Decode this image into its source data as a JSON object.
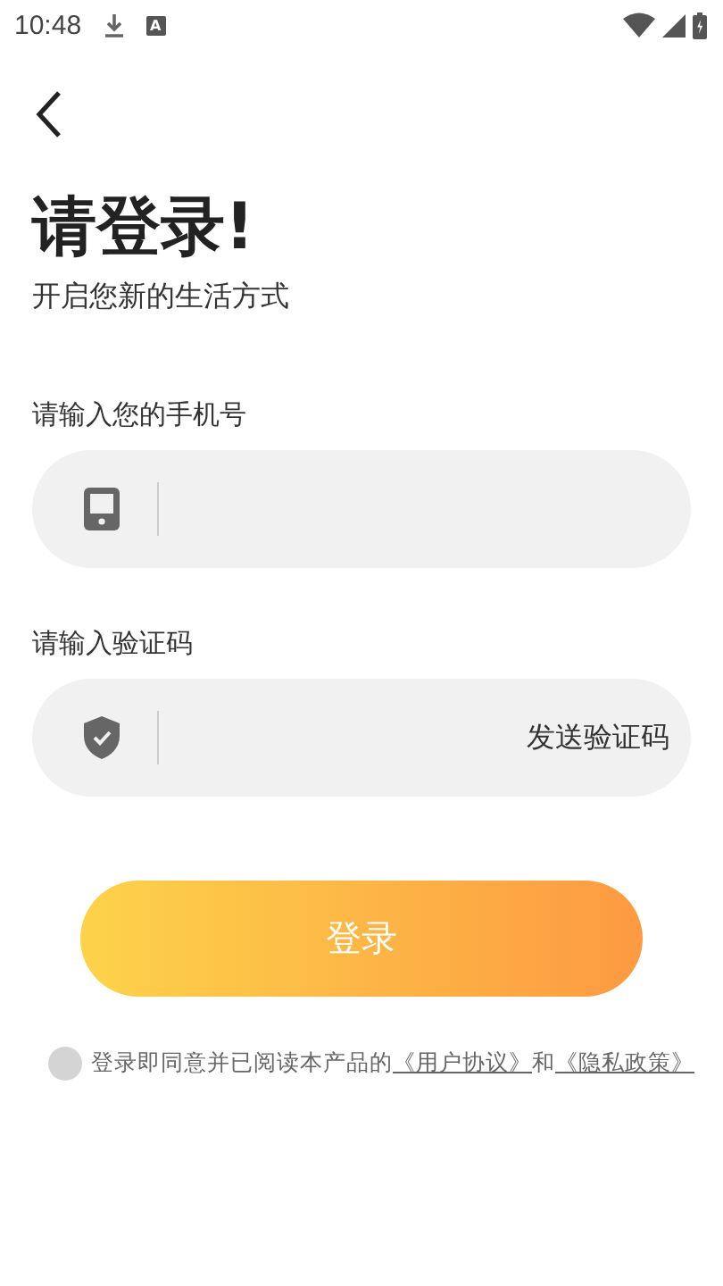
{
  "status_bar": {
    "time": "10:48",
    "notification_badge": "A"
  },
  "title": "请登录!",
  "subtitle": "开启您新的生活方式",
  "fields": [
    {
      "kind": "phone",
      "label": "请输入您的手机号"
    },
    {
      "kind": "code",
      "label": "请输入验证码",
      "action": "发送验证码"
    }
  ],
  "login_button": "登录",
  "agreement": {
    "checked": false,
    "text": "登录即同意并已阅读本产品的",
    "links": [
      "《用户协议》",
      "《隐私政策》"
    ],
    "joiner": "和"
  }
}
